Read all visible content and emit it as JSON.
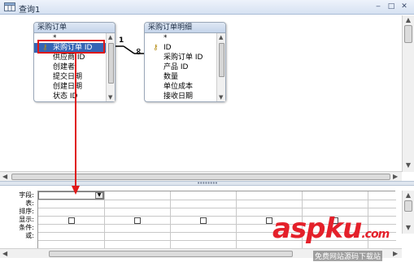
{
  "window": {
    "title": "查询1",
    "min_glyph": "‒",
    "max_glyph": "□",
    "close_glyph": "✕"
  },
  "tables": {
    "left": {
      "title": "采购订单",
      "fields": [
        "*",
        "采购订单 ID",
        "供应商 ID",
        "创建者",
        "提交日期",
        "创建日期",
        "状态 ID"
      ]
    },
    "right": {
      "title": "采购订单明细",
      "fields": [
        "*",
        "ID",
        "采购订单 ID",
        "产品 ID",
        "数量",
        "单位成本",
        "接收日期"
      ]
    }
  },
  "relationship": {
    "one_label": "1",
    "many_label": "∞"
  },
  "grid": {
    "row_labels": [
      "字段:",
      "表:",
      "排序:",
      "显示:",
      "条件:",
      "或:"
    ]
  },
  "watermark": {
    "logo": "aspku",
    "logo_suffix": ".com",
    "caption": "免费网站源码下载站"
  },
  "colors": {
    "selection": "#3565b5",
    "annotation": "#e01818",
    "watermark": "#e4202a"
  }
}
